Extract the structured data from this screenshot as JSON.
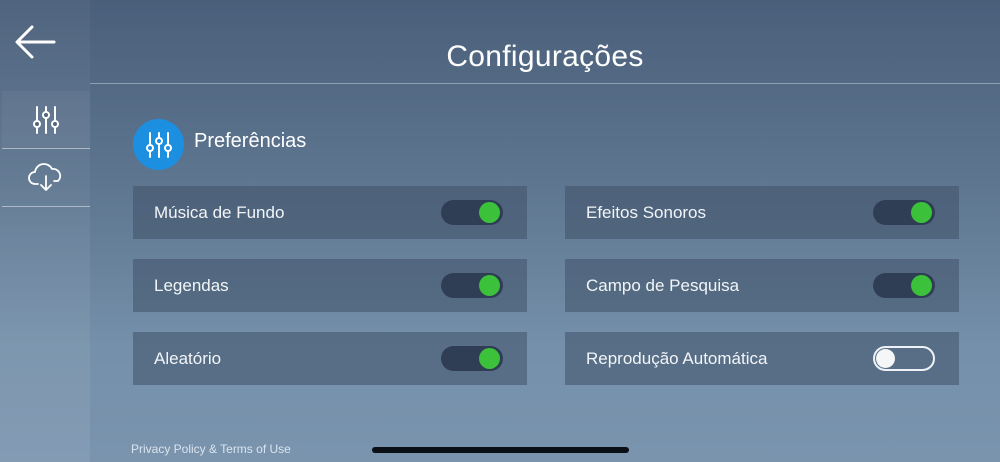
{
  "header": {
    "title": "Configurações"
  },
  "sidebar": {
    "items": [
      {
        "icon": "sliders-icon"
      },
      {
        "icon": "cloud-download-icon"
      }
    ]
  },
  "section": {
    "title": "Preferências",
    "icon": "sliders-icon"
  },
  "settings": [
    {
      "label": "Música de Fundo",
      "on": true
    },
    {
      "label": "Efeitos Sonoros",
      "on": true
    },
    {
      "label": "Legendas",
      "on": true
    },
    {
      "label": "Campo de Pesquisa",
      "on": true
    },
    {
      "label": "Aleatório",
      "on": true
    },
    {
      "label": "Reprodução Automática",
      "on": false
    }
  ],
  "footer": {
    "link": "Privacy Policy & Terms of Use"
  },
  "colors": {
    "accent": "#1d8fe0",
    "toggle_on": "#3cc13a"
  }
}
